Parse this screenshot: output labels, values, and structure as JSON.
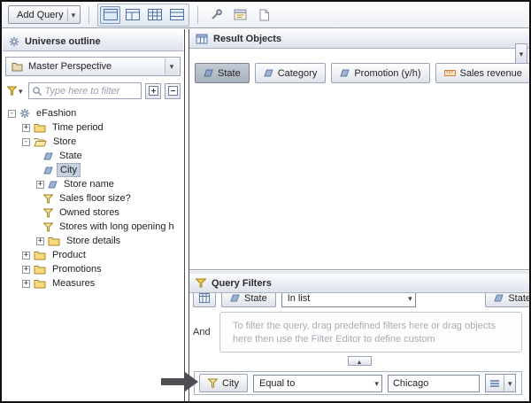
{
  "toolbar": {
    "add_query_label": "Add Query"
  },
  "universe_panel": {
    "title": "Universe outline",
    "perspective": "Master Perspective",
    "filter_placeholder": "Type here to filter",
    "tree": [
      {
        "label": "eFashion"
      },
      {
        "label": "Time period"
      },
      {
        "label": "Store"
      },
      {
        "label": "State"
      },
      {
        "label": "City"
      },
      {
        "label": "Store name"
      },
      {
        "label": "Sales floor size?"
      },
      {
        "label": "Owned stores"
      },
      {
        "label": "Stores with long opening h"
      },
      {
        "label": "Store details"
      },
      {
        "label": "Product"
      },
      {
        "label": "Promotions"
      },
      {
        "label": "Measures"
      }
    ]
  },
  "result_objects": {
    "title": "Result Objects",
    "pills": [
      {
        "label": "State"
      },
      {
        "label": "Category"
      },
      {
        "label": "Promotion (y/h)"
      },
      {
        "label": "Sales revenue"
      }
    ]
  },
  "query_filters": {
    "title": "Query Filters",
    "and_label": "And",
    "hint": "To filter the query, drag predefined filters here or drag objects here then use the Filter Editor to define custom",
    "top_row": {
      "pill_left": "State",
      "operator": "In list",
      "pill_right": "State"
    },
    "city_row": {
      "pill": "City",
      "operator": "Equal to",
      "value": "Chicago"
    }
  }
}
